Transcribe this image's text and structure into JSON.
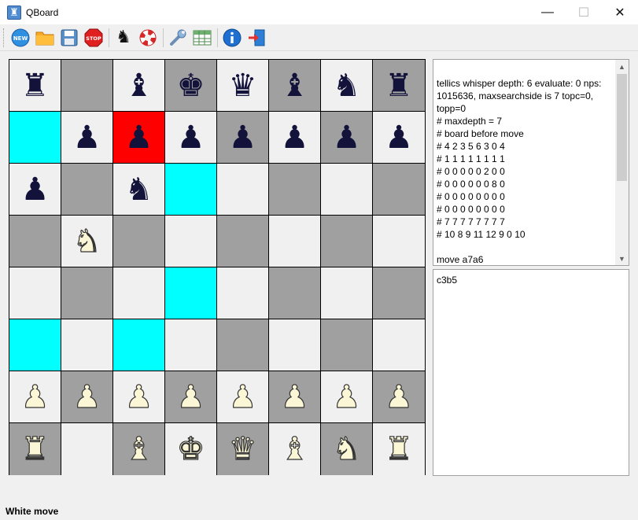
{
  "window": {
    "title": "QBoard",
    "minimize_glyph": "—",
    "maximize_glyph": "☐",
    "close_glyph": "✕"
  },
  "toolbar": {
    "buttons": [
      {
        "name": "new-game-button",
        "icon": "new-icon",
        "label": "NEW"
      },
      {
        "name": "open-button",
        "icon": "folder-icon"
      },
      {
        "name": "save-button",
        "icon": "floppy-disk-icon"
      },
      {
        "name": "stop-button",
        "icon": "stop-sign-icon",
        "label": "STOP"
      },
      {
        "name": "engine-button",
        "icon": "chess-knight-icon"
      },
      {
        "name": "help-lifebuoy-button",
        "icon": "lifebuoy-icon"
      },
      {
        "name": "settings-button",
        "icon": "wrench-icon"
      },
      {
        "name": "table-button",
        "icon": "table-grid-icon"
      },
      {
        "name": "about-button",
        "icon": "info-icon"
      },
      {
        "name": "exit-button",
        "icon": "exit-door-icon"
      }
    ]
  },
  "board": {
    "rows": [
      [
        [
          "br",
          "light"
        ],
        [
          "",
          "dark"
        ],
        [
          "bb",
          "light"
        ],
        [
          "bk",
          "dark"
        ],
        [
          "bq",
          "light"
        ],
        [
          "bb",
          "dark"
        ],
        [
          "bn",
          "light"
        ],
        [
          "br",
          "dark"
        ]
      ],
      [
        [
          "",
          "cyan"
        ],
        [
          "bp",
          "light"
        ],
        [
          "bp",
          "red"
        ],
        [
          "bp",
          "light"
        ],
        [
          "bp",
          "dark"
        ],
        [
          "bp",
          "light"
        ],
        [
          "bp",
          "dark"
        ],
        [
          "bp",
          "light"
        ]
      ],
      [
        [
          "bp",
          "light"
        ],
        [
          "",
          "dark"
        ],
        [
          "bn",
          "light"
        ],
        [
          "",
          "cyan"
        ],
        [
          "",
          "light"
        ],
        [
          "",
          "dark"
        ],
        [
          "",
          "light"
        ],
        [
          "",
          "dark"
        ]
      ],
      [
        [
          "",
          "dark"
        ],
        [
          "wn",
          "light"
        ],
        [
          "",
          "dark"
        ],
        [
          "",
          "light"
        ],
        [
          "",
          "dark"
        ],
        [
          "",
          "light"
        ],
        [
          "",
          "dark"
        ],
        [
          "",
          "light"
        ]
      ],
      [
        [
          "",
          "light"
        ],
        [
          "",
          "dark"
        ],
        [
          "",
          "light"
        ],
        [
          "",
          "cyan"
        ],
        [
          "",
          "light"
        ],
        [
          "",
          "dark"
        ],
        [
          "",
          "light"
        ],
        [
          "",
          "dark"
        ]
      ],
      [
        [
          "",
          "cyan"
        ],
        [
          "",
          "light"
        ],
        [
          "",
          "cyan"
        ],
        [
          "",
          "light"
        ],
        [
          "",
          "dark"
        ],
        [
          "",
          "light"
        ],
        [
          "",
          "dark"
        ],
        [
          "",
          "light"
        ]
      ],
      [
        [
          "wp",
          "light"
        ],
        [
          "wp",
          "dark"
        ],
        [
          "wp",
          "light"
        ],
        [
          "wp",
          "dark"
        ],
        [
          "wp",
          "light"
        ],
        [
          "wp",
          "dark"
        ],
        [
          "wp",
          "light"
        ],
        [
          "wp",
          "dark"
        ]
      ],
      [
        [
          "wr",
          "dark"
        ],
        [
          "",
          "light"
        ],
        [
          "wb",
          "dark"
        ],
        [
          "wk",
          "light"
        ],
        [
          "wq",
          "dark"
        ],
        [
          "wb",
          "light"
        ],
        [
          "wn",
          "dark"
        ],
        [
          "wr",
          "light"
        ]
      ]
    ]
  },
  "log": {
    "text": "tellics whisper depth: 6 evaluate: 0 nps: 1015636, maxsearchside is 7 topc=0, topp=0\n# maxdepth = 7\n# board before move\n# 4 2 3 5 6 3 0 4\n# 1 1 1 1 1 1 1 1\n# 0 0 0 0 0 2 0 0\n# 0 0 0 0 0 0 8 0\n# 0 0 0 0 0 0 0 0\n# 0 0 0 0 0 0 0 0\n# 7 7 7 7 7 7 7 7\n# 10 8 9 11 12 9 0 10\n\nmove a7a6"
  },
  "moves": {
    "text": "c3b5"
  },
  "status": {
    "text": "White move"
  },
  "colors": {
    "light_square": "#f0f0f0",
    "dark_square": "#a0a0a0",
    "highlight_cyan": "#00ffff",
    "highlight_red": "#ff0000",
    "black_piece": "#12123a",
    "white_piece": "#fbf7d6"
  }
}
